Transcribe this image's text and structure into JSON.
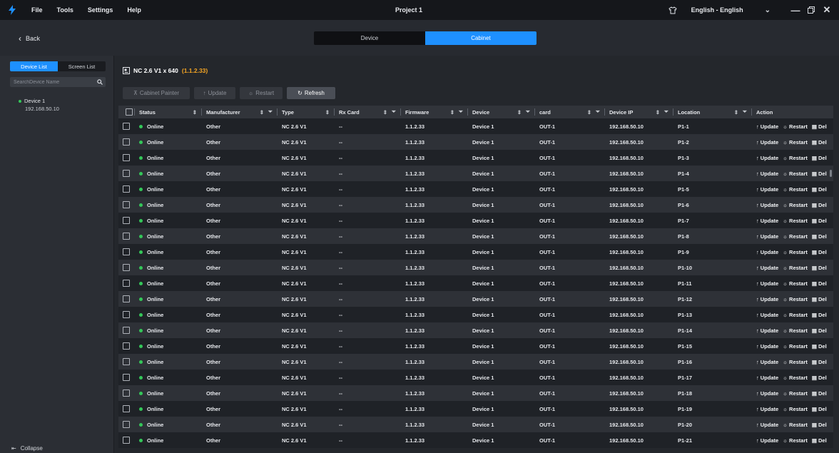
{
  "titlebar": {
    "menus": [
      "File",
      "Tools",
      "Settings",
      "Help"
    ],
    "title": "Project 1",
    "language": "English - English"
  },
  "topbar": {
    "back_label": "Back",
    "segments": [
      "Device",
      "Cabinet"
    ],
    "active_segment": "Cabinet"
  },
  "sidebar": {
    "tabs": [
      "Device List",
      "Screen List"
    ],
    "search_placeholder": "SearchDevice Name",
    "device_name": "Device 1",
    "device_ip": "192.168.50.10",
    "collapse_label": "Collapse"
  },
  "main": {
    "device_title": "NC 2.6 V1 x 640",
    "device_version": "(1.1.2.33)",
    "toolbar": {
      "cabinet_painter": "Cabinet Painter",
      "update": "Update",
      "restart": "Restart",
      "refresh": "Refresh"
    }
  },
  "table": {
    "headers": [
      "Status",
      "Manufacturer",
      "Type",
      "Rx Card",
      "Firmware",
      "Device",
      "card",
      "Device IP",
      "Location",
      "Action"
    ],
    "action_labels": {
      "update": "Update",
      "restart": "Restart",
      "delete": "Del"
    },
    "rows": [
      {
        "status": "Online",
        "manufacturer": "Other",
        "type": "NC 2.6 V1",
        "rx_card": "--",
        "firmware": "1.1.2.33",
        "device": "Device 1",
        "card": "OUT-1",
        "ip": "192.168.50.10",
        "location": "P1-1"
      },
      {
        "status": "Online",
        "manufacturer": "Other",
        "type": "NC 2.6 V1",
        "rx_card": "--",
        "firmware": "1.1.2.33",
        "device": "Device 1",
        "card": "OUT-1",
        "ip": "192.168.50.10",
        "location": "P1-2"
      },
      {
        "status": "Online",
        "manufacturer": "Other",
        "type": "NC 2.6 V1",
        "rx_card": "--",
        "firmware": "1.1.2.33",
        "device": "Device 1",
        "card": "OUT-1",
        "ip": "192.168.50.10",
        "location": "P1-3"
      },
      {
        "status": "Online",
        "manufacturer": "Other",
        "type": "NC 2.6 V1",
        "rx_card": "--",
        "firmware": "1.1.2.33",
        "device": "Device 1",
        "card": "OUT-1",
        "ip": "192.168.50.10",
        "location": "P1-4"
      },
      {
        "status": "Online",
        "manufacturer": "Other",
        "type": "NC 2.6 V1",
        "rx_card": "--",
        "firmware": "1.1.2.33",
        "device": "Device 1",
        "card": "OUT-1",
        "ip": "192.168.50.10",
        "location": "P1-5"
      },
      {
        "status": "Online",
        "manufacturer": "Other",
        "type": "NC 2.6 V1",
        "rx_card": "--",
        "firmware": "1.1.2.33",
        "device": "Device 1",
        "card": "OUT-1",
        "ip": "192.168.50.10",
        "location": "P1-6"
      },
      {
        "status": "Online",
        "manufacturer": "Other",
        "type": "NC 2.6 V1",
        "rx_card": "--",
        "firmware": "1.1.2.33",
        "device": "Device 1",
        "card": "OUT-1",
        "ip": "192.168.50.10",
        "location": "P1-7"
      },
      {
        "status": "Online",
        "manufacturer": "Other",
        "type": "NC 2.6 V1",
        "rx_card": "--",
        "firmware": "1.1.2.33",
        "device": "Device 1",
        "card": "OUT-1",
        "ip": "192.168.50.10",
        "location": "P1-8"
      },
      {
        "status": "Online",
        "manufacturer": "Other",
        "type": "NC 2.6 V1",
        "rx_card": "--",
        "firmware": "1.1.2.33",
        "device": "Device 1",
        "card": "OUT-1",
        "ip": "192.168.50.10",
        "location": "P1-9"
      },
      {
        "status": "Online",
        "manufacturer": "Other",
        "type": "NC 2.6 V1",
        "rx_card": "--",
        "firmware": "1.1.2.33",
        "device": "Device 1",
        "card": "OUT-1",
        "ip": "192.168.50.10",
        "location": "P1-10"
      },
      {
        "status": "Online",
        "manufacturer": "Other",
        "type": "NC 2.6 V1",
        "rx_card": "--",
        "firmware": "1.1.2.33",
        "device": "Device 1",
        "card": "OUT-1",
        "ip": "192.168.50.10",
        "location": "P1-11"
      },
      {
        "status": "Online",
        "manufacturer": "Other",
        "type": "NC 2.6 V1",
        "rx_card": "--",
        "firmware": "1.1.2.33",
        "device": "Device 1",
        "card": "OUT-1",
        "ip": "192.168.50.10",
        "location": "P1-12"
      },
      {
        "status": "Online",
        "manufacturer": "Other",
        "type": "NC 2.6 V1",
        "rx_card": "--",
        "firmware": "1.1.2.33",
        "device": "Device 1",
        "card": "OUT-1",
        "ip": "192.168.50.10",
        "location": "P1-13"
      },
      {
        "status": "Online",
        "manufacturer": "Other",
        "type": "NC 2.6 V1",
        "rx_card": "--",
        "firmware": "1.1.2.33",
        "device": "Device 1",
        "card": "OUT-1",
        "ip": "192.168.50.10",
        "location": "P1-14"
      },
      {
        "status": "Online",
        "manufacturer": "Other",
        "type": "NC 2.6 V1",
        "rx_card": "--",
        "firmware": "1.1.2.33",
        "device": "Device 1",
        "card": "OUT-1",
        "ip": "192.168.50.10",
        "location": "P1-15"
      },
      {
        "status": "Online",
        "manufacturer": "Other",
        "type": "NC 2.6 V1",
        "rx_card": "--",
        "firmware": "1.1.2.33",
        "device": "Device 1",
        "card": "OUT-1",
        "ip": "192.168.50.10",
        "location": "P1-16"
      },
      {
        "status": "Online",
        "manufacturer": "Other",
        "type": "NC 2.6 V1",
        "rx_card": "--",
        "firmware": "1.1.2.33",
        "device": "Device 1",
        "card": "OUT-1",
        "ip": "192.168.50.10",
        "location": "P1-17"
      },
      {
        "status": "Online",
        "manufacturer": "Other",
        "type": "NC 2.6 V1",
        "rx_card": "--",
        "firmware": "1.1.2.33",
        "device": "Device 1",
        "card": "OUT-1",
        "ip": "192.168.50.10",
        "location": "P1-18"
      },
      {
        "status": "Online",
        "manufacturer": "Other",
        "type": "NC 2.6 V1",
        "rx_card": "--",
        "firmware": "1.1.2.33",
        "device": "Device 1",
        "card": "OUT-1",
        "ip": "192.168.50.10",
        "location": "P1-19"
      },
      {
        "status": "Online",
        "manufacturer": "Other",
        "type": "NC 2.6 V1",
        "rx_card": "--",
        "firmware": "1.1.2.33",
        "device": "Device 1",
        "card": "OUT-1",
        "ip": "192.168.50.10",
        "location": "P1-20"
      },
      {
        "status": "Online",
        "manufacturer": "Other",
        "type": "NC 2.6 V1",
        "rx_card": "--",
        "firmware": "1.1.2.33",
        "device": "Device 1",
        "card": "OUT-1",
        "ip": "192.168.50.10",
        "location": "P1-21"
      }
    ]
  },
  "colors": {
    "accent": "#1e90ff",
    "online": "#34c759",
    "version": "#f5a524"
  }
}
